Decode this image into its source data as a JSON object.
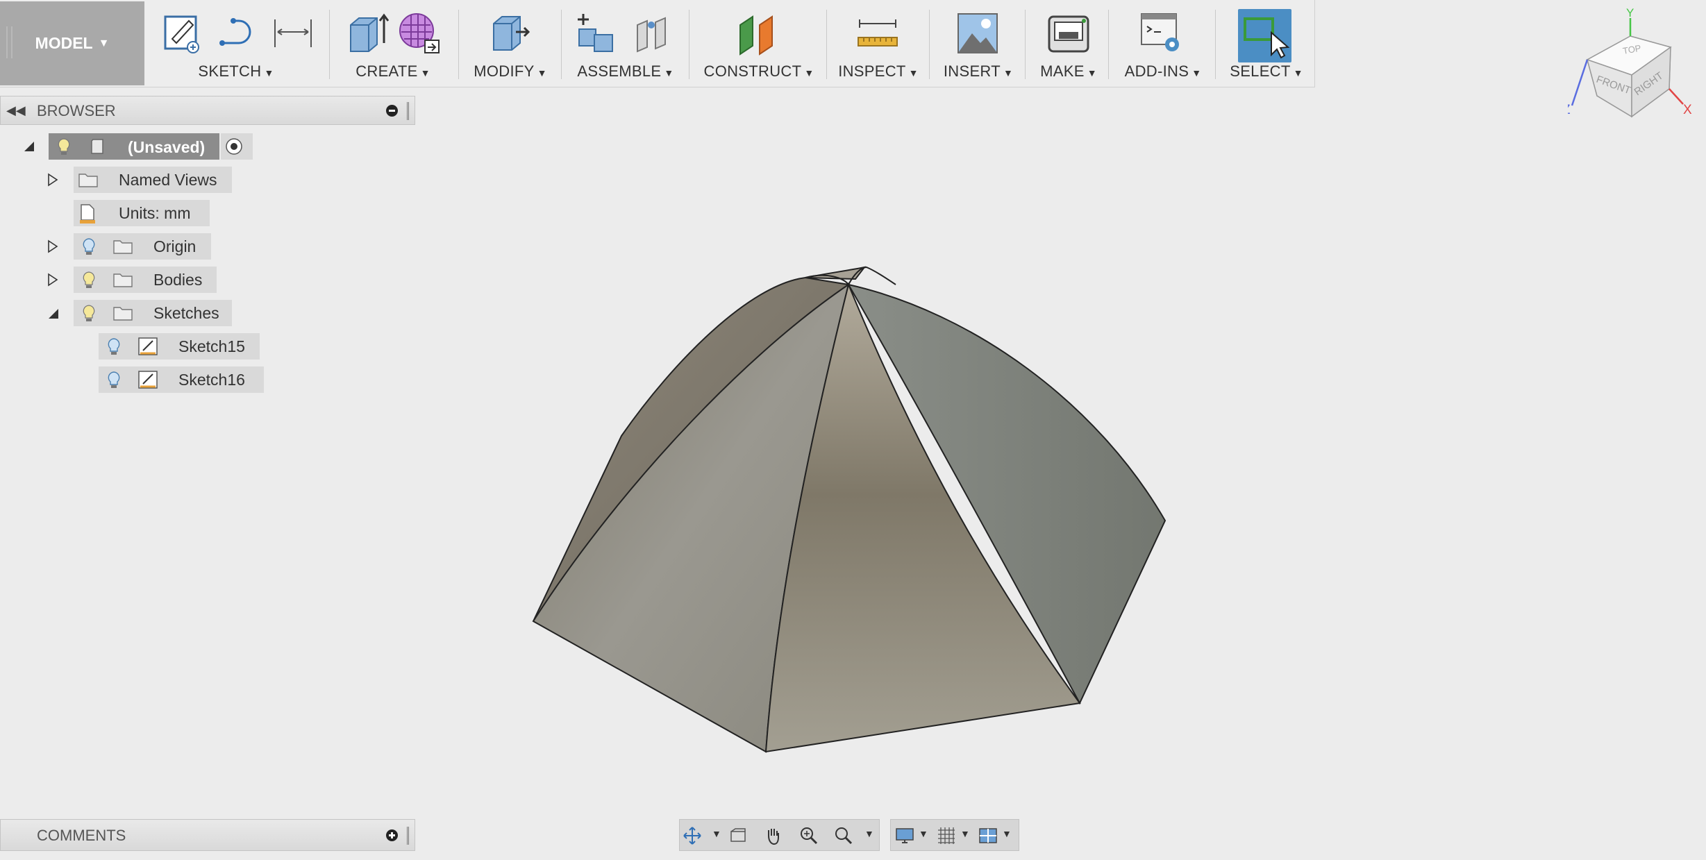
{
  "toolbar": {
    "mode_label": "MODEL",
    "groups": {
      "sketch": "SKETCH",
      "create": "CREATE",
      "modify": "MODIFY",
      "assemble": "ASSEMBLE",
      "construct": "CONSTRUCT",
      "inspect": "INSPECT",
      "insert": "INSERT",
      "make": "MAKE",
      "addins": "ADD-INS",
      "select": "SELECT"
    }
  },
  "browser": {
    "title": "BROWSER",
    "root": "(Unsaved)",
    "items": [
      {
        "label": "Named Views"
      },
      {
        "label": "Units: mm"
      },
      {
        "label": "Origin"
      },
      {
        "label": "Bodies"
      },
      {
        "label": "Sketches"
      },
      {
        "label": "Sketch15"
      },
      {
        "label": "Sketch16"
      }
    ]
  },
  "comments": {
    "title": "COMMENTS"
  },
  "viewcube": {
    "top": "TOP",
    "front": "FRONT",
    "right": "RIGHT",
    "axis_x": "X",
    "axis_y": "Y",
    "axis_z": "Z"
  },
  "colors": {
    "select_active": "#4b8ec4",
    "model_button": "#a9a9a9",
    "background": "#ececec"
  }
}
